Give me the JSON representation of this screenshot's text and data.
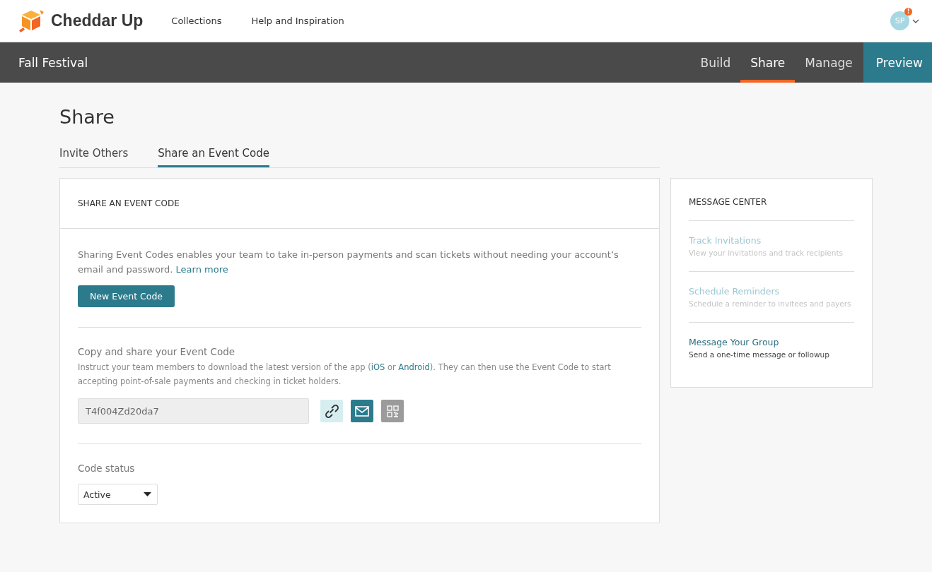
{
  "header": {
    "brand": "Cheddar Up",
    "nav": [
      "Collections",
      "Help and Inspiration"
    ],
    "avatar": {
      "initials": "SP",
      "alert": "!"
    }
  },
  "collection_bar": {
    "title": "Fall Festival",
    "tabs": [
      {
        "label": "Build",
        "kind": "tab",
        "selected": false
      },
      {
        "label": "Share",
        "kind": "tab",
        "selected": true
      },
      {
        "label": "Manage",
        "kind": "tab",
        "selected": false
      },
      {
        "label": "Preview",
        "kind": "button",
        "selected": false
      }
    ]
  },
  "page": {
    "title": "Share",
    "tabs": [
      {
        "label": "Invite Others",
        "selected": false
      },
      {
        "label": "Share an Event Code",
        "selected": true
      }
    ]
  },
  "card": {
    "heading": "SHARE AN EVENT CODE",
    "intro": [
      {
        "kind": "text",
        "text": "Sharing Event Codes enables your team to take in-person payments and scan tickets without needing your account’s email and password. "
      },
      {
        "kind": "link",
        "text": "Learn more"
      }
    ],
    "new_button": "New Event Code",
    "copy_title": "Copy and share your Event Code",
    "copy_text": [
      {
        "kind": "text",
        "text": "Instruct your team members to download the latest version of the app ("
      },
      {
        "kind": "link",
        "text": "iOS"
      },
      {
        "kind": "text",
        "text": " or "
      },
      {
        "kind": "link",
        "text": "Android"
      },
      {
        "kind": "text",
        "text": "). They can then use the Event Code to start accepting point-of-sale payments and checking in ticket holders."
      }
    ],
    "code": "T4f004Zd20da7",
    "status_label": "Code status",
    "status_value": "Active"
  },
  "message_center": {
    "heading": "MESSAGE CENTER",
    "items": [
      {
        "title": "Track Invitations",
        "subtitle": "View your invitations and track recipients",
        "disabled": true
      },
      {
        "title": "Schedule Reminders",
        "subtitle": "Schedule a reminder to invitees and payers",
        "disabled": true
      },
      {
        "title": "Message Your Group",
        "subtitle": "Send a one-time message or followup",
        "disabled": false
      }
    ]
  }
}
